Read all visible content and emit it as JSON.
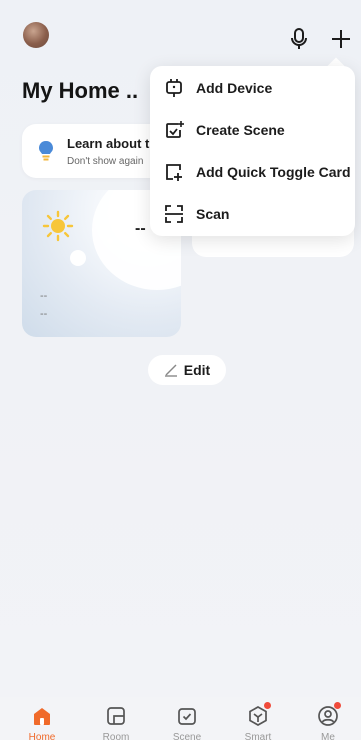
{
  "header": {
    "home_title": "My Home ..",
    "icons": [
      "avatar",
      "microphone-icon",
      "plus-icon"
    ]
  },
  "tip": {
    "title": "Learn about t",
    "subtitle": "Don't show again"
  },
  "weather": {
    "temp": "--",
    "line1": "--",
    "line2": "--"
  },
  "edit": {
    "label": "Edit"
  },
  "menu": {
    "items": [
      {
        "label": "Add Device",
        "icon": "add-device-icon"
      },
      {
        "label": "Create Scene",
        "icon": "create-scene-icon"
      },
      {
        "label": "Add Quick Toggle Card",
        "icon": "add-card-icon"
      },
      {
        "label": "Scan",
        "icon": "scan-icon"
      }
    ]
  },
  "tabs": [
    {
      "label": "Home",
      "icon": "home-icon",
      "active": true
    },
    {
      "label": "Room",
      "icon": "room-icon"
    },
    {
      "label": "Scene",
      "icon": "scene-icon"
    },
    {
      "label": "Smart",
      "icon": "smart-icon"
    },
    {
      "label": "Me",
      "icon": "profile-icon"
    }
  ],
  "colors": {
    "accent": "#f06a2a",
    "badge": "#f04a3a",
    "bulb": "#4a8ad8",
    "sun": "#f7c63a"
  }
}
